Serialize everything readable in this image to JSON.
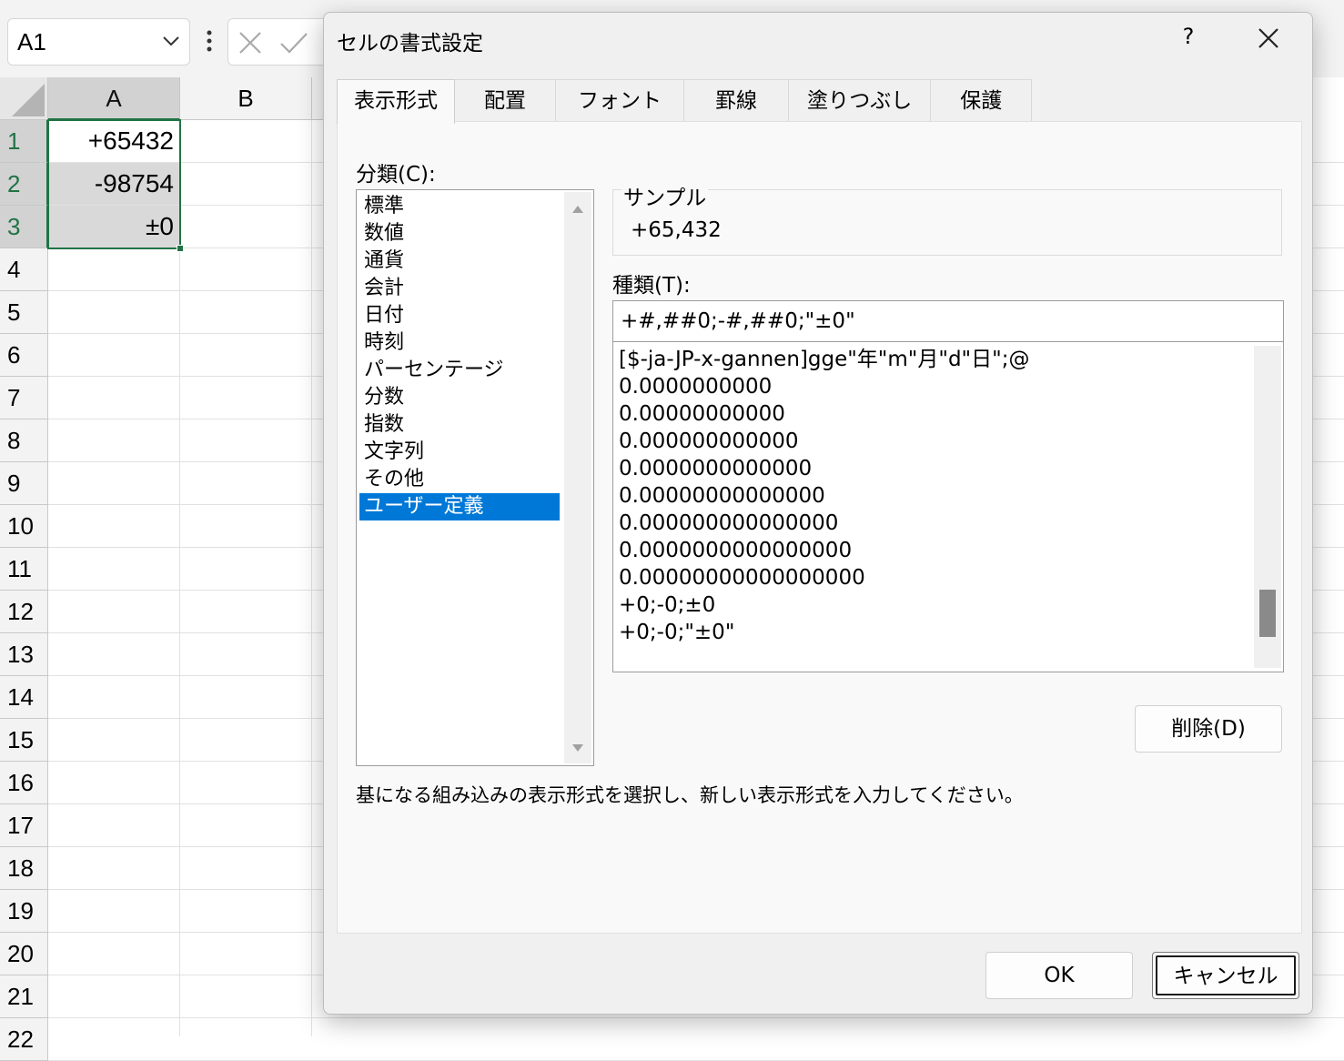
{
  "sheet": {
    "name_box": "A1",
    "columns": [
      "A",
      "B"
    ],
    "rows": [
      "1",
      "2",
      "3",
      "4",
      "5",
      "6",
      "7",
      "8",
      "9",
      "10",
      "11",
      "12",
      "13",
      "14",
      "15",
      "16",
      "17",
      "18",
      "19",
      "20",
      "21",
      "22"
    ],
    "cells": [
      "+65432",
      "-98754",
      "±0"
    ]
  },
  "dialog": {
    "title": "セルの書式設定",
    "help": "?",
    "tabs": [
      "表示形式",
      "配置",
      "フォント",
      "罫線",
      "塗りつぶし",
      "保護"
    ],
    "category_label": "分類(C):",
    "categories": [
      "標準",
      "数値",
      "通貨",
      "会計",
      "日付",
      "時刻",
      "パーセンテージ",
      "分数",
      "指数",
      "文字列",
      "その他",
      "ユーザー定義"
    ],
    "sample_label": "サンプル",
    "sample_value": "+65,432",
    "type_label": "種類(T):",
    "type_value": "+#,##0;-#,##0;\"±0\"",
    "format_list": [
      "[$-ja-JP-x-gannen]gge\"年\"m\"月\"d\"日\";@",
      "0.0000000000",
      "0.00000000000",
      "0.000000000000",
      "0.0000000000000",
      "0.00000000000000",
      "0.000000000000000",
      "0.0000000000000000",
      "0.00000000000000000",
      "+0;-0;±0",
      "+0;-0;\"±0\""
    ],
    "delete_button": "削除(D)",
    "hint": "基になる組み込みの表示形式を選択し、新しい表示形式を入力してください。",
    "ok_button": "OK",
    "cancel_button": "キャンセル"
  }
}
